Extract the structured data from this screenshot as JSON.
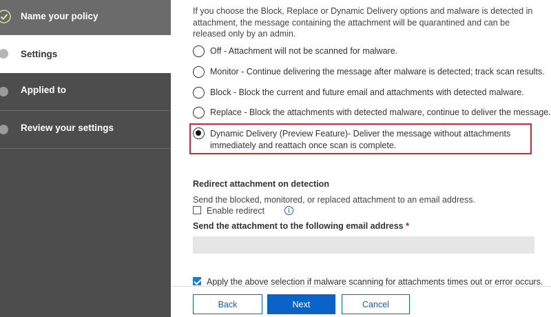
{
  "sidebar": {
    "steps": [
      {
        "label": "Name your policy",
        "state": "completed"
      },
      {
        "label": "Settings",
        "state": "active"
      },
      {
        "label": "Applied to",
        "state": "pending"
      },
      {
        "label": "Review your settings",
        "state": "pending"
      }
    ]
  },
  "main": {
    "intro": "If you choose the Block, Replace or Dynamic Delivery options and malware is detected in attachment, the message containing the attachment will be quarantined and can be released only by an admin.",
    "options": [
      {
        "label": "Off - Attachment will not be scanned for malware.",
        "selected": false
      },
      {
        "label": "Monitor - Continue delivering the message after malware is detected; track scan results.",
        "selected": false
      },
      {
        "label": "Block - Block the current and future email and attachments with detected malware.",
        "selected": false
      },
      {
        "label": "Replace - Block the attachments with detected malware, continue to deliver the message.",
        "selected": false
      },
      {
        "label": "Dynamic Delivery (Preview Feature)- Deliver the message without attachments immediately and reattach once scan is complete.",
        "selected": true
      }
    ],
    "redirect": {
      "title": "Redirect attachment on detection",
      "description": "Send the blocked, monitored, or replaced attachment to an email address.",
      "enable_label": "Enable redirect",
      "enable_checked": false,
      "email_label": "Send the attachment to the following email address",
      "required_marker": "*",
      "email_value": ""
    },
    "apply": {
      "label": "Apply the above selection if malware scanning for attachments times out or error occurs.",
      "checked": true
    }
  },
  "footer": {
    "back_label": "Back",
    "next_label": "Next",
    "cancel_label": "Cancel"
  },
  "colors": {
    "sidebar_bg": "#4d4d4d",
    "accent": "#0a63c9",
    "highlight": "#d9232e",
    "complete": "#7dc242"
  }
}
